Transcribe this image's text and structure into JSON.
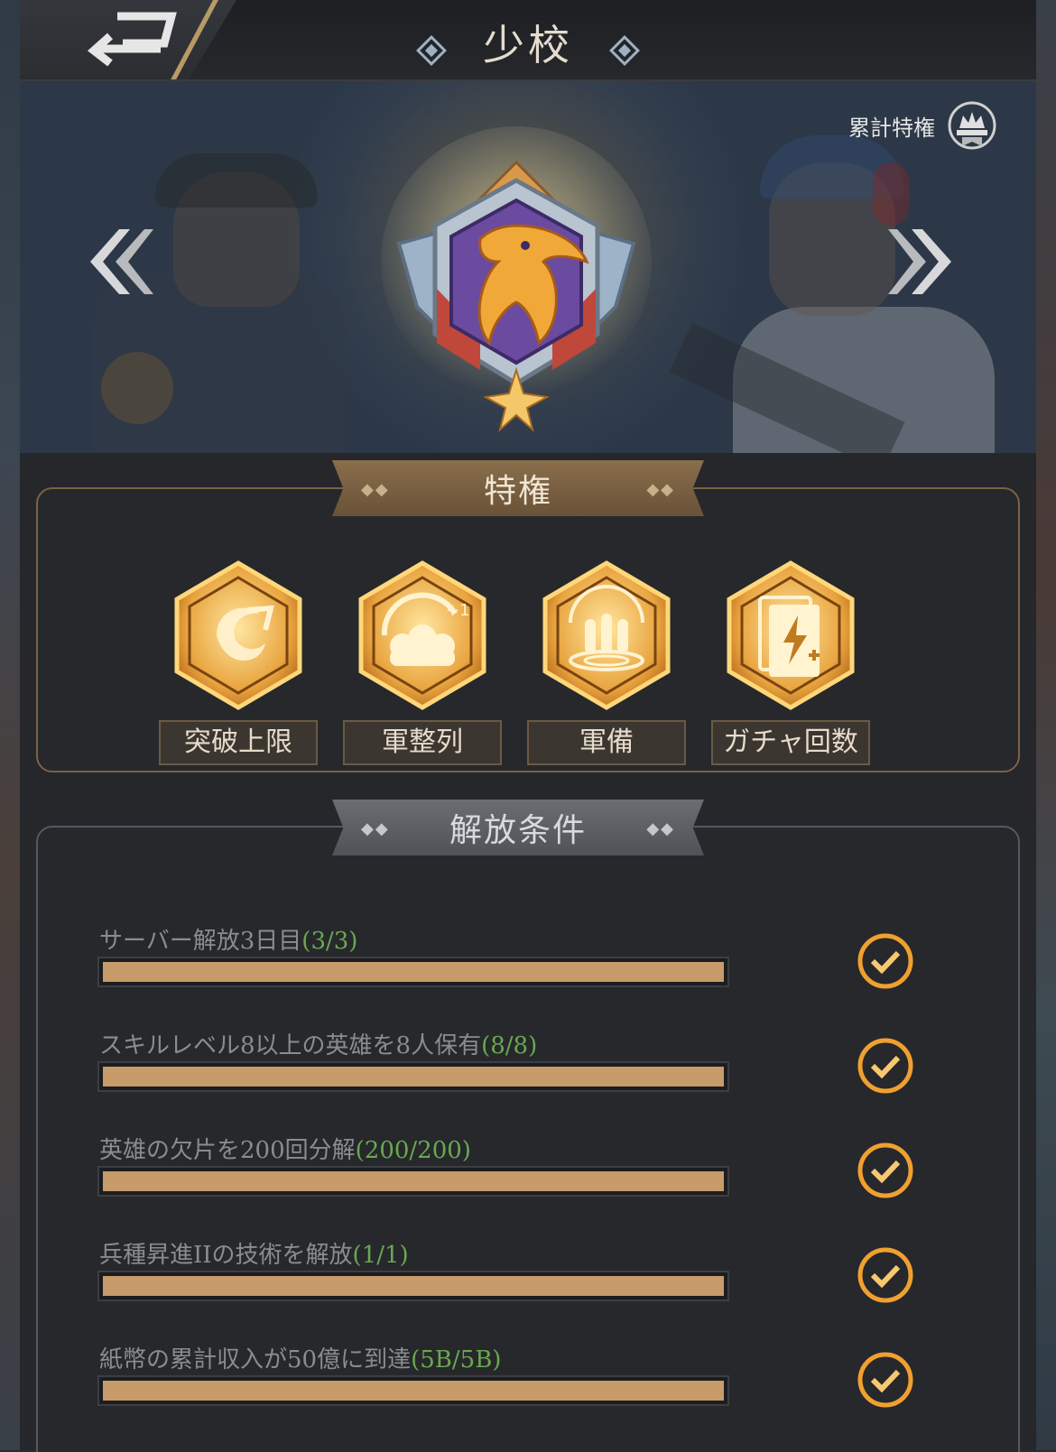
{
  "header": {
    "title": "少校",
    "back_icon": "back-arrow-icon"
  },
  "banner": {
    "cumulative_label": "累計特権",
    "cumulative_icon": "crown-ribbon-icon",
    "emblem_icon": "eagle-rank-badge-icon"
  },
  "privileges": {
    "heading": "特権",
    "items": [
      {
        "label": "突破上限",
        "icon": "breakthrough-swirl-icon"
      },
      {
        "label": "軍整列",
        "icon": "squad-plus-one-icon"
      },
      {
        "label": "軍備",
        "icon": "ammo-bullets-icon"
      },
      {
        "label": "ガチャ回数",
        "icon": "gacha-card-lightning-icon"
      }
    ]
  },
  "conditions": {
    "heading": "解放条件",
    "items": [
      {
        "text": "サーバー解放3日目",
        "progress": "(3/3)",
        "fraction": 1.0,
        "done": true
      },
      {
        "text": "スキルレベル8以上の英雄を8人保有",
        "progress": "(8/8)",
        "fraction": 1.0,
        "done": true
      },
      {
        "text": "英雄の欠片を200回分解",
        "progress": "(200/200)",
        "fraction": 1.0,
        "done": true
      },
      {
        "text": "兵種昇進IIの技術を解放",
        "progress": "(1/1)",
        "fraction": 1.0,
        "done": true
      },
      {
        "text": "紙幣の累計収入が50億に到達",
        "progress": "(5B/5B)",
        "fraction": 1.0,
        "done": true
      }
    ]
  },
  "colors": {
    "accent_gold": "#c89b6a",
    "progress_green": "#6aa84f",
    "frame_gold": "#7a6344"
  }
}
